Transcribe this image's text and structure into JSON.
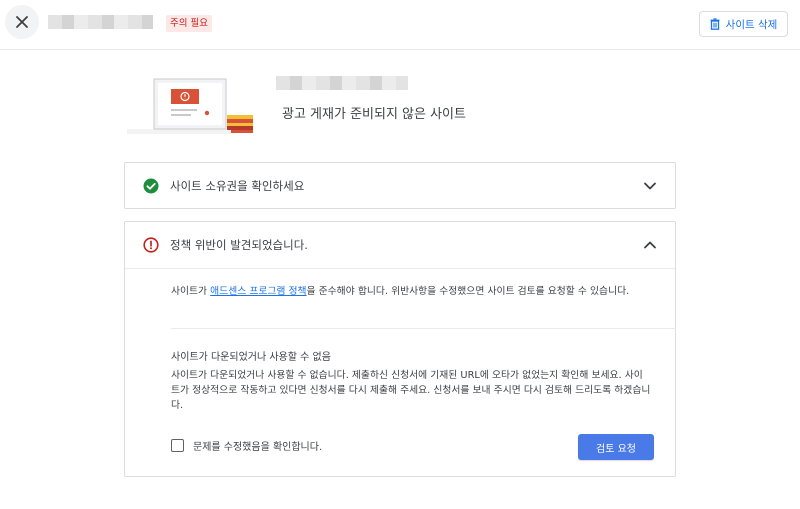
{
  "header": {
    "status_badge": "주의 필요",
    "delete_button_label": "사이트 삭제"
  },
  "hero": {
    "title": "광고 게재가 준비되지 않은 사이트"
  },
  "ownership_card": {
    "label": "사이트 소유권을 확인하세요",
    "status_color": "#1e8e3e"
  },
  "policy_card": {
    "label": "정책 위반이 발견되었습니다.",
    "status_color": "#c5221f",
    "intro_before": "사이트가 ",
    "intro_link": "애드센스 프로그램 정책",
    "intro_after": "을 준수해야 합니다. 위반사항을 수정했으면 사이트 검토를 요청할 수 있습니다.",
    "issue_title": "사이트가 다운되었거나 사용할 수 없음",
    "issue_body": "사이트가 다운되었거나 사용할 수 없습니다. 제출하신 신청서에 기재된 URL에 오타가 없었는지 확인해 보세요. 사이트가 정상적으로 작동하고 있다면 신청서를 다시 제출해 주세요. 신청서를 보내 주시면 다시 검토해 드리도록 하겠습니다.",
    "confirm_label": "문제를 수정했음을 확인합니다.",
    "review_button_label": "검토 요청"
  },
  "colors": {
    "accent": "#1a73e8",
    "primary_button": "#4a7ae8",
    "badge_bg": "#fce8e6",
    "badge_text": "#c5221f"
  }
}
